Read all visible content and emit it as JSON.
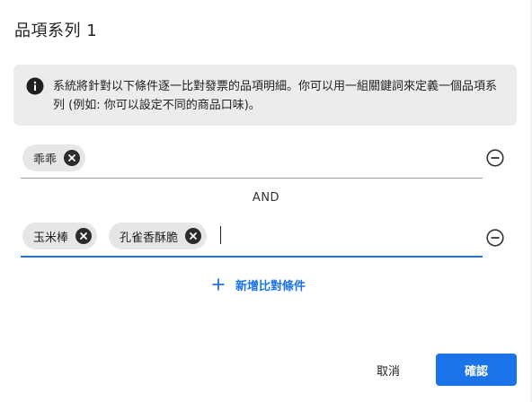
{
  "dialog": {
    "title": "品項系列 1",
    "info": {
      "icon": "info-icon",
      "text": "系統將針對以下條件逐一比對發票的品項明細。你可以用一組關鍵詞來定義一個品項系列 (例如: 你可以設定不同的商品口味)。"
    },
    "conditions": [
      {
        "chips": [
          {
            "label": "乖乖"
          }
        ],
        "remove_icon": "minus-circle-icon"
      },
      {
        "chips": [
          {
            "label": "玉米棒"
          },
          {
            "label": "孔雀香酥脆"
          }
        ],
        "remove_icon": "minus-circle-icon"
      }
    ],
    "operator": "AND",
    "add_condition_label": "新增比對條件",
    "cancel_label": "取消",
    "confirm_label": "確認",
    "colors": {
      "accent": "#1a73e8",
      "info_bg": "#ececec",
      "chip_bg": "#e6e6e6"
    }
  }
}
